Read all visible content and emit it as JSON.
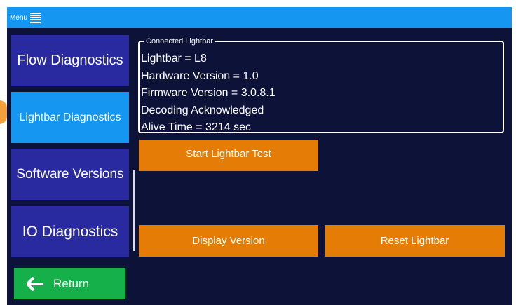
{
  "topbar": {
    "menu_label": "Menu",
    "menu_icon": "hamburger-icon",
    "color": "#1596f0"
  },
  "sidebar": {
    "items": [
      {
        "label": "Flow Diagnostics",
        "selected": false
      },
      {
        "label": "Lightbar Diagnostics",
        "selected": true
      },
      {
        "label": "Software Versions",
        "selected": false
      },
      {
        "label": "IO Diagnostics",
        "selected": false
      }
    ]
  },
  "panel": {
    "legend": "Connected Lightbar",
    "lines": [
      "Lightbar = L8",
      "Hardware Version = 1.0",
      "Firmware Version = 3.0.8.1",
      "Decoding Acknowledged",
      "Alive Time = 3214 sec"
    ]
  },
  "buttons": {
    "start_test": "Start Lightbar Test",
    "display_version": "Display Version",
    "reset_lightbar": "Reset Lightbar"
  },
  "return_button": {
    "label": "Return",
    "icon": "arrow-left-icon"
  },
  "colors": {
    "background": "#0d1239",
    "nav": "#2a2aa0",
    "nav_selected": "#1596f0",
    "action": "#e47c06",
    "return": "#16b04a"
  }
}
